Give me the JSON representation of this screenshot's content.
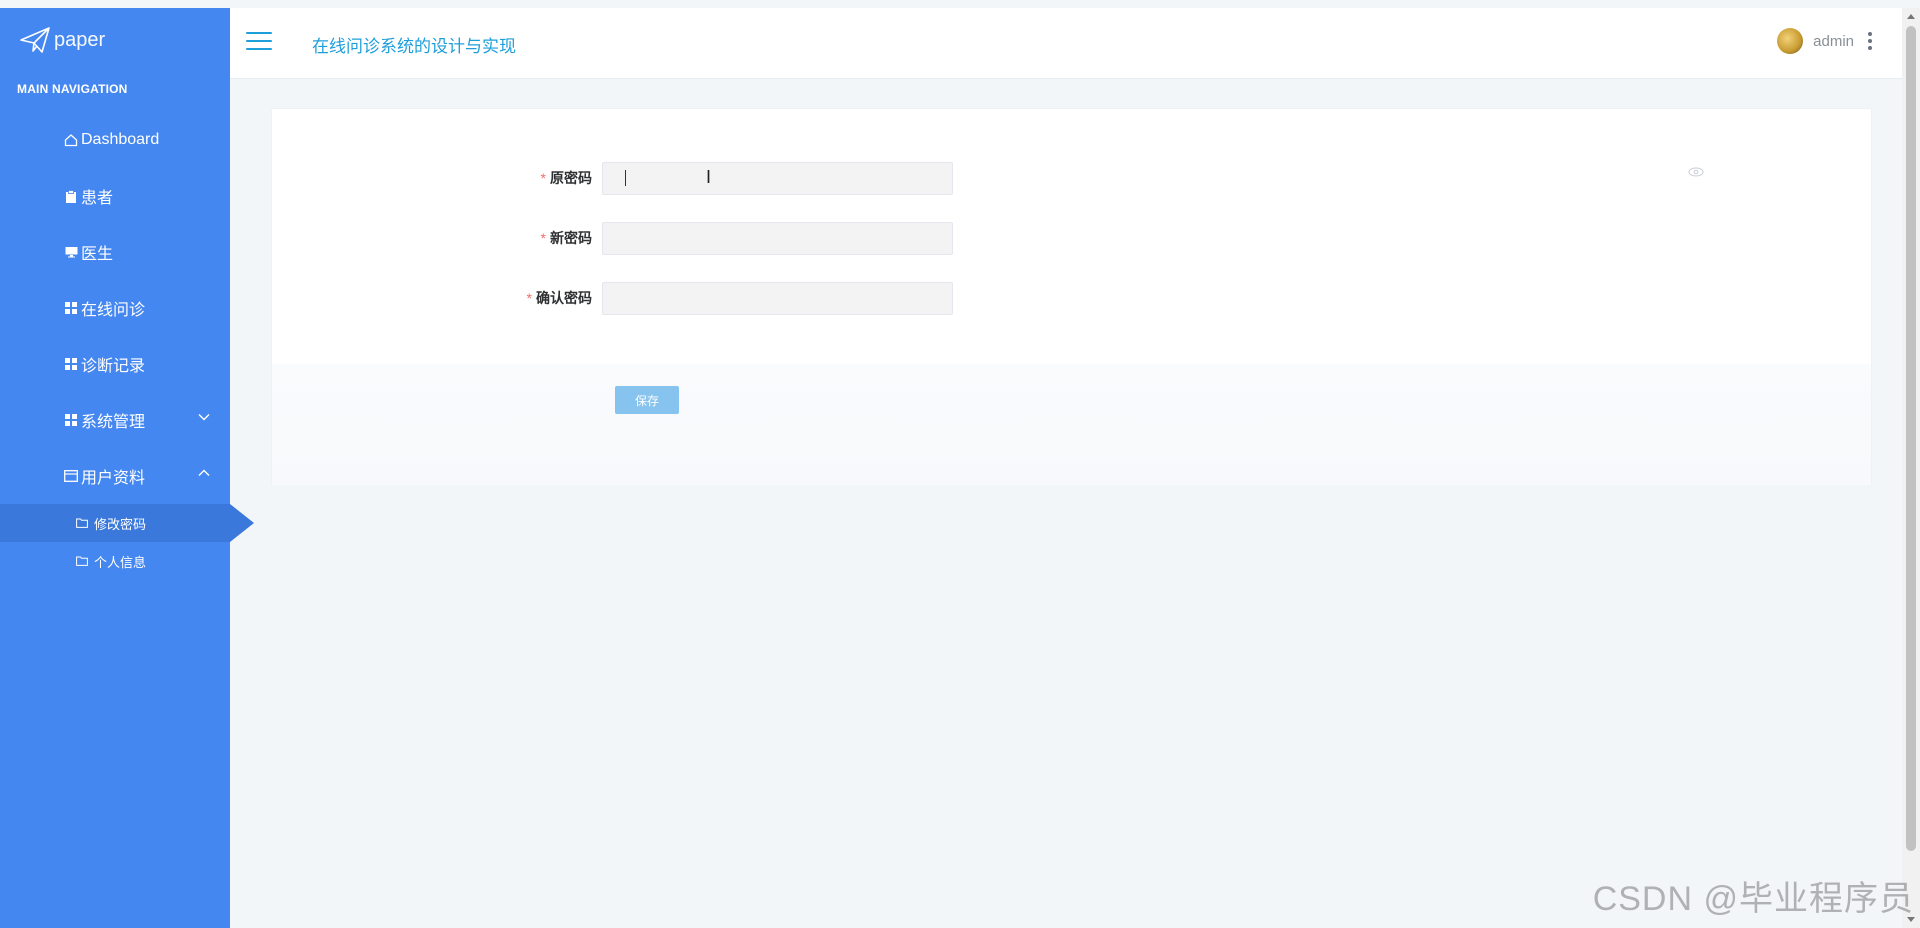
{
  "brand": {
    "name": "paper"
  },
  "sidebar": {
    "header": "MAIN NAVIGATION",
    "items": [
      {
        "label": "Dashboard",
        "icon": "home-icon"
      },
      {
        "label": "患者",
        "icon": "clipboard-icon"
      },
      {
        "label": "医生",
        "icon": "monitor-icon"
      },
      {
        "label": "在线问诊",
        "icon": "grid-icon"
      },
      {
        "label": "诊断记录",
        "icon": "grid-icon"
      },
      {
        "label": "系统管理",
        "icon": "grid-icon",
        "expanded": false
      },
      {
        "label": "用户资料",
        "icon": "card-icon",
        "expanded": true
      }
    ],
    "sub_items": [
      {
        "label": "修改密码",
        "icon": "folder-icon",
        "active": true
      },
      {
        "label": "个人信息",
        "icon": "folder-icon",
        "active": false
      }
    ]
  },
  "header": {
    "title": "在线问诊系统的设计与实现",
    "username": "admin"
  },
  "form": {
    "old_password_label": "原密码",
    "new_password_label": "新密码",
    "confirm_password_label": "确认密码",
    "old_password_value": "",
    "new_password_value": "",
    "confirm_password_value": "",
    "required_mark": "*",
    "save_label": "保存"
  },
  "watermark": "CSDN @毕业程序员",
  "colors": {
    "sidebar": "#4587f0",
    "accent": "#1e9fd9",
    "save_button": "#86c3ee",
    "required": "#f56c6c"
  }
}
